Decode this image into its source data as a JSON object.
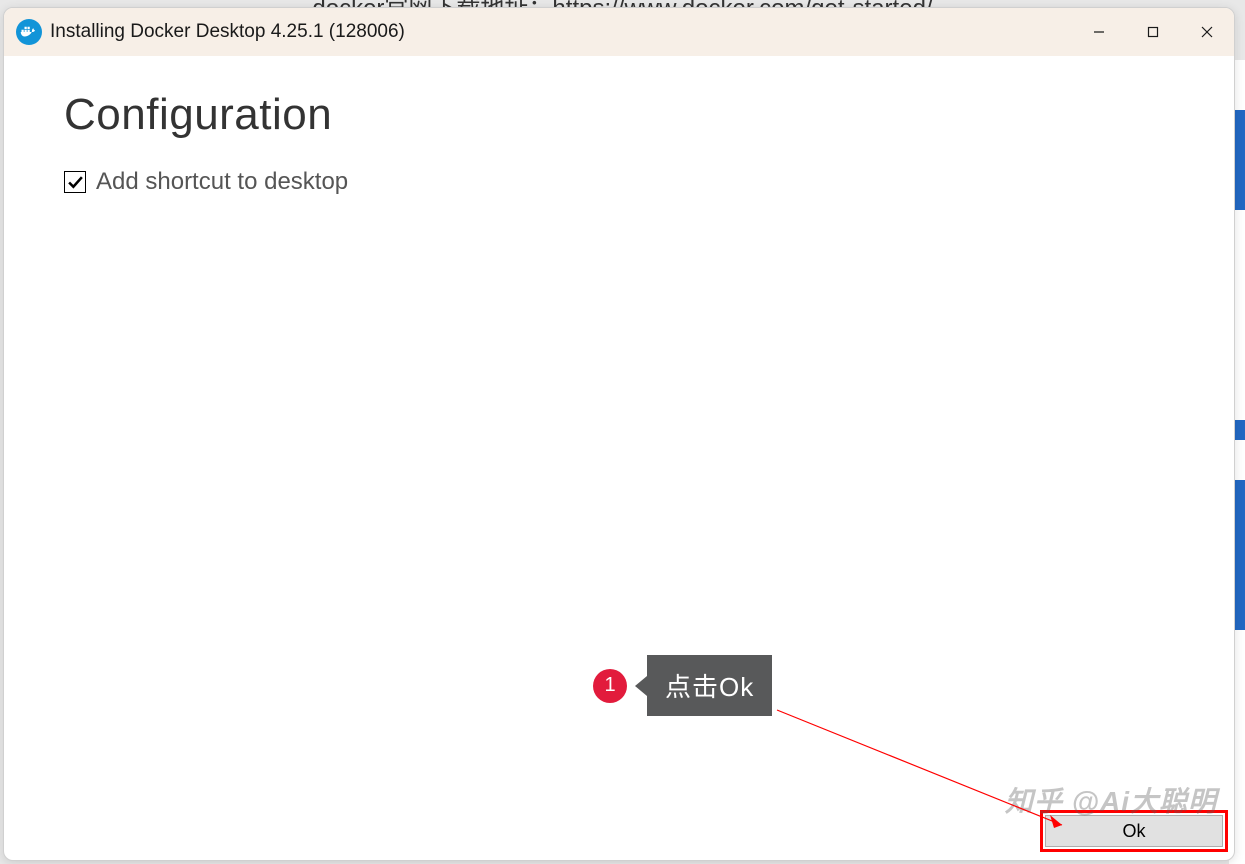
{
  "background": {
    "top_text": "docker官网下载地址：https://www.docker.com/get-started/"
  },
  "window": {
    "title": "Installing Docker Desktop 4.25.1 (128006)",
    "heading": "Configuration",
    "checkbox": {
      "label": "Add shortcut to desktop",
      "checked": true
    },
    "ok_button": "Ok"
  },
  "annotation": {
    "number": "1",
    "text": "点击Ok"
  },
  "watermark": "知乎 @Ai大聪明"
}
